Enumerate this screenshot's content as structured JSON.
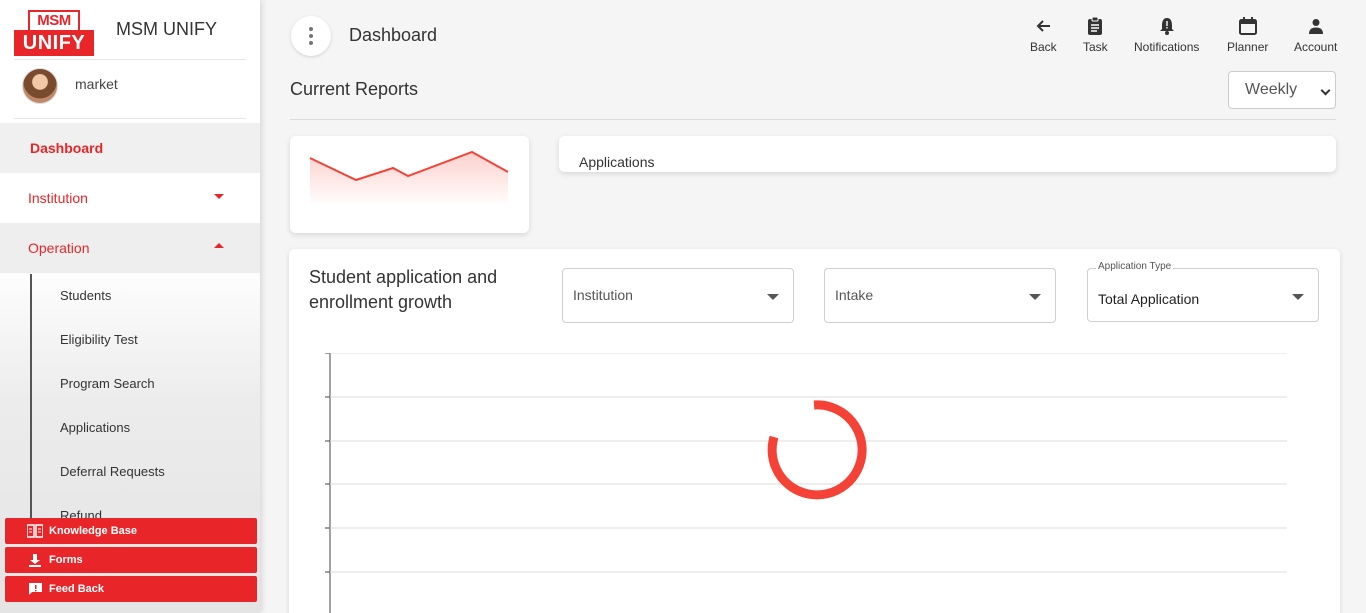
{
  "app": {
    "logo_top": "MSM",
    "logo_bottom": "UNIFY",
    "title": "MSM UNIFY"
  },
  "user": {
    "name": "market"
  },
  "sidebar": {
    "items": [
      {
        "label": "Dashboard",
        "active": true
      },
      {
        "label": "Institution",
        "caret": "down"
      },
      {
        "label": "Operation",
        "caret": "up"
      }
    ],
    "submenu": [
      "Students",
      "Eligibility Test",
      "Program Search",
      "Applications",
      "Deferral Requests",
      "Refund"
    ],
    "bottom_buttons": [
      {
        "label": "Knowledge Base",
        "icon": "book-icon"
      },
      {
        "label": "Forms",
        "icon": "download-icon"
      },
      {
        "label": "Feed Back",
        "icon": "feedback-icon"
      }
    ]
  },
  "header": {
    "title": "Dashboard",
    "actions": [
      {
        "label": "Back",
        "icon": "arrow-left-icon"
      },
      {
        "label": "Task",
        "icon": "clipboard-icon"
      },
      {
        "label": "Notifications",
        "icon": "bell-icon"
      },
      {
        "label": "Planner",
        "icon": "calendar-icon"
      },
      {
        "label": "Account",
        "icon": "person-icon"
      }
    ]
  },
  "reports": {
    "title": "Current Reports",
    "period": "Weekly",
    "applications_label": "Applications"
  },
  "growth": {
    "title": "Student application and enrollment growth",
    "filters": {
      "institution_placeholder": "Institution",
      "intake_placeholder": "Intake",
      "type_label": "Application Type",
      "type_value": "Total Application"
    }
  },
  "colors": {
    "brand": "#e8262a",
    "spinner": "#f44336"
  }
}
